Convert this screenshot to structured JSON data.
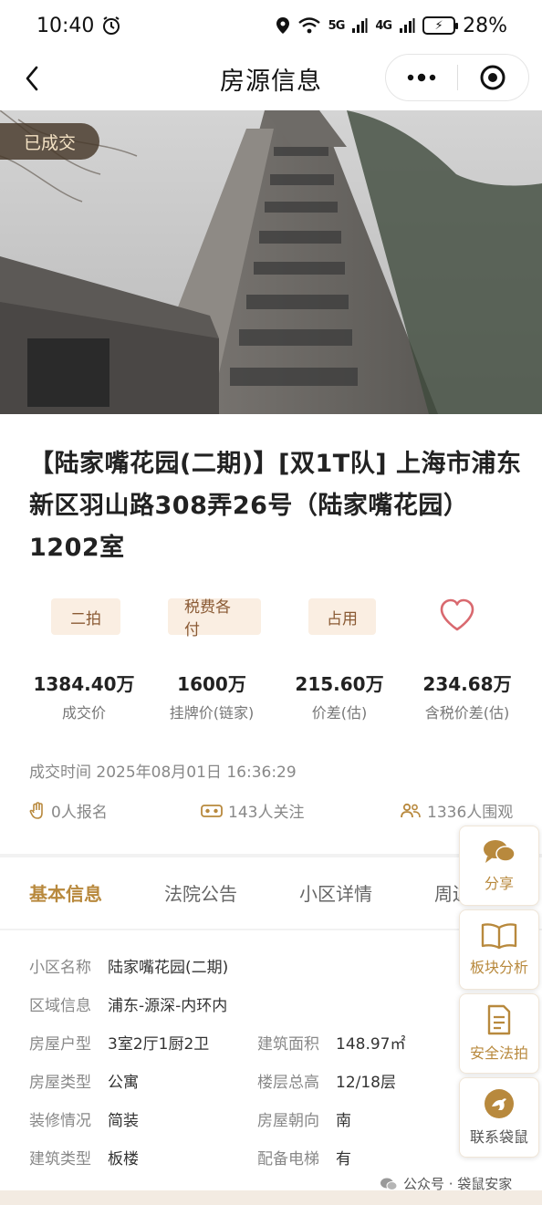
{
  "status_bar": {
    "time": "10:40",
    "network_5g": "5G",
    "network_4g": "4G",
    "battery": "28%"
  },
  "header": {
    "title": "房源信息"
  },
  "hero": {
    "sold_badge": "已成交"
  },
  "listing": {
    "title": "【陆家嘴花园(二期)】[双1T队] 上海市浦东新区羽山路308弄26号（陆家嘴花园）1202室",
    "tags": [
      "二拍",
      "税费各付",
      "占用"
    ],
    "prices": [
      {
        "value": "1384.40万",
        "label": "成交价"
      },
      {
        "value": "1600万",
        "label": "挂牌价(链家)"
      },
      {
        "value": "215.60万",
        "label": "价差(估)"
      },
      {
        "value": "234.68万",
        "label": "含税价差(估)"
      }
    ],
    "deal_time": "成交时间 2025年08月01日 16:36:29",
    "stats": {
      "signups": "0人报名",
      "followers": "143人关注",
      "viewers": "1336人围观"
    }
  },
  "tabs": [
    {
      "label": "基本信息",
      "active": true
    },
    {
      "label": "法院公告",
      "active": false
    },
    {
      "label": "小区详情",
      "active": false
    },
    {
      "label": "周边",
      "active": false
    }
  ],
  "basic_info": {
    "community": {
      "label": "小区名称",
      "value": "陆家嘴花园(二期)"
    },
    "region": {
      "label": "区域信息",
      "value": "浦东-源深-内环内"
    },
    "layout": {
      "label": "房屋户型",
      "value": "3室2厅1厨2卫"
    },
    "area": {
      "label": "建筑面积",
      "value": "148.97㎡"
    },
    "house_type": {
      "label": "房屋类型",
      "value": "公寓"
    },
    "floor": {
      "label": "楼层总高",
      "value": "12/18层"
    },
    "decoration": {
      "label": "装修情况",
      "value": "简装"
    },
    "orientation": {
      "label": "房屋朝向",
      "value": "南"
    },
    "building_type": {
      "label": "建筑类型",
      "value": "板楼"
    },
    "elevator": {
      "label": "配备电梯",
      "value": "有"
    }
  },
  "side_actions": {
    "share": "分享",
    "analysis": "板块分析",
    "safety": "安全法拍",
    "contact": "联系袋鼠"
  },
  "watermark": "公众号 · 袋鼠安家",
  "colors": {
    "accent": "#b8893d",
    "tag_bg": "#faeee2",
    "tag_text": "#8a5a34",
    "heart": "#d9696f"
  }
}
